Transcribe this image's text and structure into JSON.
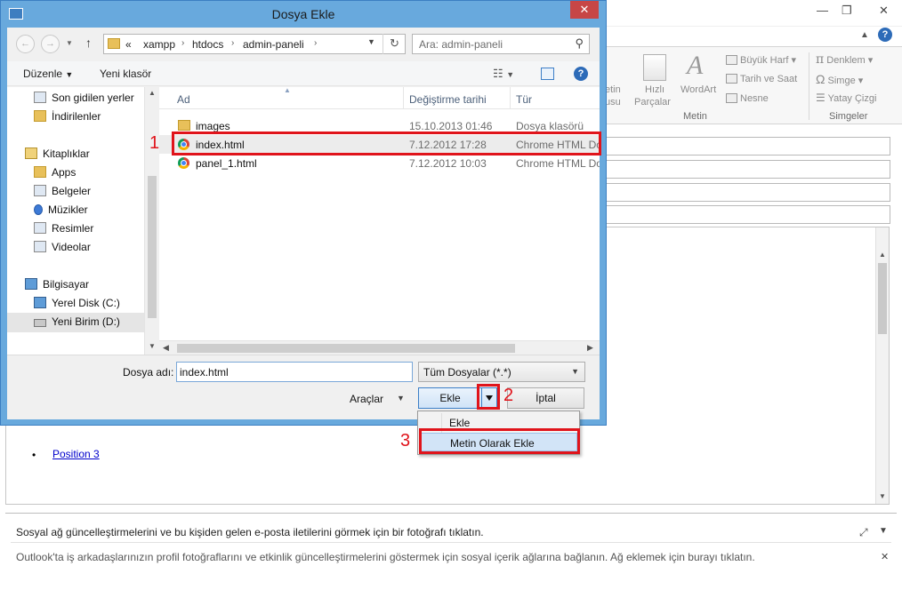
{
  "background": {
    "ribbon": {
      "wordart_partial_left": "etin",
      "wordart_partial_left2": "usu",
      "hizli": "Hızlı",
      "parcalar": "Parçalar",
      "wordart": "WordArt",
      "buyuk_harf": "Büyük Harf",
      "tarih_saat": "Tarih ve Saat",
      "nesne": "Nesne",
      "denklem": "Denklem",
      "simge": "Simge",
      "yatay_cizgi": "Yatay Çizgi",
      "group_metin": "Metin",
      "group_simgeler": "Simgeler"
    },
    "editor": {
      "link_text": "Position 3"
    },
    "people_pane": {
      "line1": "Sosyal ağ güncelleştirmelerini ve bu kişiden gelen e-posta iletilerini görmek için bir fotoğrafı tıklatın.",
      "line2": "Outlook'ta iş arkadaşlarınızın profil fotoğraflarını ve etkinlik güncelleştirmelerini göstermek için sosyal içerik ağlarına bağlanın. Ağ eklemek için burayı tıklatın."
    }
  },
  "dialog": {
    "title": "Dosya Ekle",
    "close_icon": "✕",
    "address": {
      "crumbs": [
        "«",
        "xampp",
        "htdocs",
        "admin-paneli"
      ],
      "separator": "›",
      "search_placeholder": "Ara: admin-paneli"
    },
    "toolbar": {
      "organize": "Düzenle",
      "new_folder": "Yeni klasör"
    },
    "nav": {
      "items": [
        {
          "label": "Son gidilen yerler",
          "icon": "recent-places-icon"
        },
        {
          "label": "İndirilenler",
          "icon": "downloads-icon"
        },
        {
          "label": "Kitaplıklar",
          "icon": "libraries-icon"
        },
        {
          "label": "Apps",
          "icon": "folder-icon"
        },
        {
          "label": "Belgeler",
          "icon": "documents-icon"
        },
        {
          "label": "Müzikler",
          "icon": "music-icon"
        },
        {
          "label": "Resimler",
          "icon": "pictures-icon"
        },
        {
          "label": "Videolar",
          "icon": "videos-icon"
        },
        {
          "label": "Bilgisayar",
          "icon": "computer-icon"
        },
        {
          "label": "Yerel Disk (C:)",
          "icon": "local-disk-icon"
        },
        {
          "label": "Yeni Birim (D:)",
          "icon": "drive-icon"
        }
      ]
    },
    "columns": {
      "name": "Ad",
      "date": "Değiştirme tarihi",
      "type": "Tür"
    },
    "files": [
      {
        "name": "images",
        "date": "15.10.2013 01:46",
        "type": "Dosya klasörü",
        "icon": "folder-icon"
      },
      {
        "name": "index.html",
        "date": "7.12.2012 17:28",
        "type": "Chrome HTML Do",
        "icon": "chrome-icon"
      },
      {
        "name": "panel_1.html",
        "date": "7.12.2012 10:03",
        "type": "Chrome HTML Do",
        "icon": "chrome-icon"
      }
    ],
    "bottom": {
      "filename_label": "Dosya adı:",
      "filename_value": "index.html",
      "filetype_value": "Tüm Dosyalar (*.*)",
      "tools_label": "Araçlar",
      "insert_label": "Ekle",
      "cancel_label": "İptal"
    },
    "insert_menu": {
      "items": [
        "Ekle",
        "Metin Olarak Ekle"
      ]
    }
  },
  "annotations": {
    "step1": "1",
    "step2": "2",
    "step3": "3",
    "color": "#e0141b"
  }
}
